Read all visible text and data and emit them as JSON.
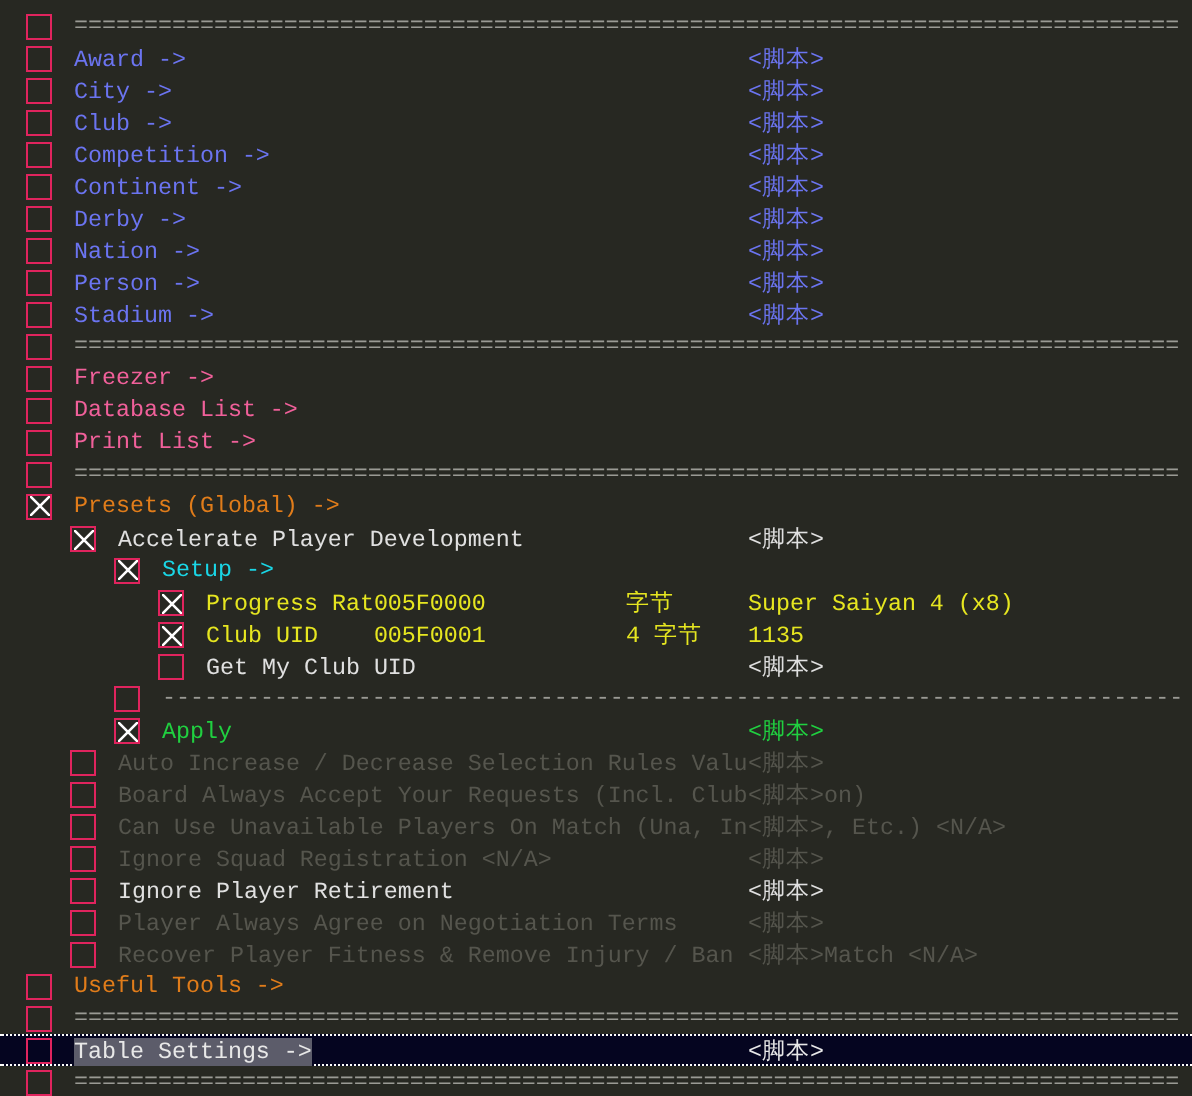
{
  "entries": [
    {
      "kind": "separator",
      "label": "===============================================================================",
      "checked": false
    },
    {
      "kind": "entry",
      "label": "Award ->",
      "color": "#6b74f0",
      "checked": false,
      "value": "<脚本>"
    },
    {
      "kind": "entry",
      "label": "City ->",
      "color": "#6b74f0",
      "checked": false,
      "value": "<脚本>"
    },
    {
      "kind": "entry",
      "label": "Club ->",
      "color": "#6b74f0",
      "checked": false,
      "value": "<脚本>"
    },
    {
      "kind": "entry",
      "label": "Competition ->",
      "color": "#6b74f0",
      "checked": false,
      "value": "<脚本>"
    },
    {
      "kind": "entry",
      "label": "Continent ->",
      "color": "#6b74f0",
      "checked": false,
      "value": "<脚本>"
    },
    {
      "kind": "entry",
      "label": "Derby ->",
      "color": "#6b74f0",
      "checked": false,
      "value": "<脚本>"
    },
    {
      "kind": "entry",
      "label": "Nation ->",
      "color": "#6b74f0",
      "checked": false,
      "value": "<脚本>"
    },
    {
      "kind": "entry",
      "label": "Person ->",
      "color": "#6b74f0",
      "checked": false,
      "value": "<脚本>"
    },
    {
      "kind": "entry",
      "label": "Stadium ->",
      "color": "#6b74f0",
      "checked": false,
      "value": "<脚本>"
    },
    {
      "kind": "separator",
      "label": "===============================================================================",
      "checked": false
    },
    {
      "kind": "entry",
      "label": "Freezer ->",
      "color": "#f0609a",
      "checked": false
    },
    {
      "kind": "entry",
      "label": "Database List ->",
      "color": "#f0609a",
      "checked": false
    },
    {
      "kind": "entry",
      "label": "Print List ->",
      "color": "#f0609a",
      "checked": false
    },
    {
      "kind": "separator",
      "label": "===============================================================================",
      "checked": false
    },
    {
      "kind": "entry",
      "label": "Presets (Global) ->",
      "color": "#e07c1a",
      "checked": true,
      "children": [
        {
          "kind": "entry",
          "label": "Accelerate Player Development",
          "color": "#e0e0e0",
          "checked": true,
          "value": "<脚本>",
          "children": [
            {
              "kind": "entry",
              "label": "Setup ->",
              "color": "#1ad6e6",
              "checked": true,
              "children": [
                {
                  "kind": "entry",
                  "label": "Progress Rat005F0000",
                  "color": "#e6e620",
                  "checked": true,
                  "type": "字节",
                  "value": "Super Saiyan 4 (x8)"
                },
                {
                  "kind": "entry",
                  "label": "Club UID    005F0001",
                  "color": "#e6e620",
                  "checked": true,
                  "type": "4 字节",
                  "value": "1135"
                },
                {
                  "kind": "entry",
                  "label": "Get My Club UID",
                  "color": "#e0e0e0",
                  "checked": false,
                  "value": "<脚本>"
                }
              ]
            },
            {
              "kind": "separator",
              "label": "-------------------------------------------------------------------------",
              "checked": false
            },
            {
              "kind": "entry",
              "label": "Apply",
              "color": "#20d040",
              "checked": true,
              "value": "<脚本>"
            }
          ]
        },
        {
          "kind": "entry",
          "label": "Auto Increase / Decrease Selection Rules Valu",
          "disabled": true,
          "checked": false,
          "value": "<脚本>"
        },
        {
          "kind": "entry",
          "label": "Board Always Accept Your Requests (Incl. Club",
          "disabled": true,
          "checked": false,
          "value": "<脚本>",
          "tail": "on)"
        },
        {
          "kind": "entry",
          "label": "Can Use Unavailable Players On Match (Una, In",
          "disabled": true,
          "checked": false,
          "value": "<脚本>",
          "tail": ", Etc.) <N/A>"
        },
        {
          "kind": "entry",
          "label": "Ignore Squad Registration <N/A>",
          "disabled": true,
          "checked": false,
          "value": "<脚本>"
        },
        {
          "kind": "entry",
          "label": "Ignore Player Retirement",
          "color": "#e0e0e0",
          "disabled": false,
          "checked": false,
          "value": "<脚本>"
        },
        {
          "kind": "entry",
          "label": "Player Always Agree on Negotiation Terms",
          "disabled": true,
          "checked": false,
          "value": "<脚本>"
        },
        {
          "kind": "entry",
          "label": "Recover Player Fitness & Remove Injury / Ban",
          "disabled": true,
          "checked": false,
          "value": "<脚本>",
          "tail": "Match <N/A>"
        }
      ]
    },
    {
      "kind": "entry",
      "label": "Useful Tools ->",
      "color": "#e07c1a",
      "checked": false
    },
    {
      "kind": "separator",
      "label": "===============================================================================",
      "checked": false
    },
    {
      "kind": "entry",
      "label": "Table Settings ->",
      "checked": false,
      "selected": true,
      "value": "<脚本>"
    },
    {
      "kind": "separator",
      "label": "===============================================================================",
      "checked": false
    }
  ]
}
